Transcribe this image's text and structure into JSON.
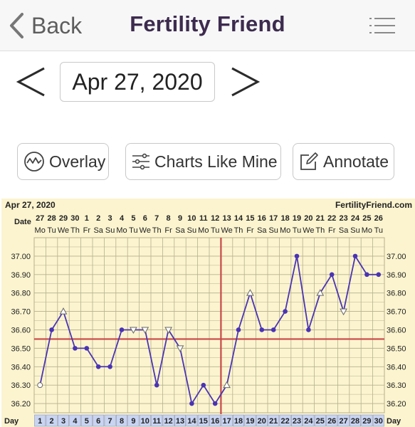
{
  "header": {
    "back_label": "Back",
    "title": "Fertility Friend",
    "back_icon": "chevron-left-icon",
    "menu_icon": "hamburger-menu-icon"
  },
  "date_nav": {
    "date": "Apr 27, 2020",
    "prev_icon": "chevron-left-icon",
    "next_icon": "chevron-right-icon"
  },
  "actions": {
    "overlay_label": "Overlay",
    "charts_like_mine_label": "Charts Like Mine",
    "annotate_label": "Annotate"
  },
  "chart_data": {
    "type": "line",
    "title": "Apr 27, 2020",
    "source": "FertilityFriend.com",
    "row_labels": {
      "date": "Date",
      "day": "Day"
    },
    "dates": [
      "27",
      "28",
      "29",
      "30",
      "1",
      "2",
      "3",
      "4",
      "5",
      "6",
      "7",
      "8",
      "9",
      "10",
      "11",
      "12",
      "13",
      "14",
      "15",
      "16",
      "17",
      "18",
      "19",
      "20",
      "21",
      "22",
      "23",
      "24",
      "25",
      "26"
    ],
    "weekdays": [
      "Mo",
      "Tu",
      "We",
      "Th",
      "Fr",
      "Sa",
      "Su",
      "Mo",
      "Tu",
      "We",
      "Th",
      "Fr",
      "Sa",
      "Su",
      "Mo",
      "Tu",
      "We",
      "Th",
      "Fr",
      "Sa",
      "Su",
      "Mo",
      "Tu",
      "We",
      "Th",
      "Fr",
      "Sa",
      "Su",
      "Mo",
      "Tu"
    ],
    "x": [
      1,
      2,
      3,
      4,
      5,
      6,
      7,
      8,
      9,
      10,
      11,
      12,
      13,
      14,
      15,
      16,
      17,
      18,
      19,
      20,
      21,
      22,
      23,
      24,
      25,
      26,
      27,
      28,
      29,
      30
    ],
    "temps": [
      36.3,
      36.6,
      36.7,
      36.5,
      36.5,
      36.4,
      36.4,
      36.6,
      36.6,
      36.6,
      36.3,
      36.6,
      36.5,
      36.2,
      36.3,
      36.2,
      36.3,
      36.6,
      36.8,
      36.6,
      36.6,
      36.7,
      37.0,
      36.6,
      36.8,
      36.9,
      36.7,
      37.0,
      36.9,
      36.9
    ],
    "markers": [
      "open-circle",
      "dot",
      "open-triangle-up",
      "dot",
      "dot",
      "dot",
      "dot",
      "dot",
      "open-triangle-down",
      "open-triangle-down",
      "dot",
      "open-triangle-down",
      "open-triangle-down",
      "dot",
      "dot",
      "dot",
      "open-triangle-up",
      "dot",
      "open-triangle-up",
      "dot",
      "dot",
      "dot",
      "dot",
      "dot",
      "open-triangle-up",
      "dot",
      "open-triangle-down",
      "dot",
      "dot",
      "dot"
    ],
    "y_ticks": [
      "36.20",
      "36.30",
      "36.40",
      "36.50",
      "36.60",
      "36.70",
      "36.80",
      "36.90",
      "37.00"
    ],
    "ylim": [
      36.15,
      37.1
    ],
    "coverline": 36.55,
    "ovulation_day": 17,
    "colors": {
      "background": "#fbf4cf",
      "line": "#4a34b4",
      "coverline": "#c84848",
      "grid": "#b8b08e",
      "day_cell": "#c8d4f2"
    }
  }
}
